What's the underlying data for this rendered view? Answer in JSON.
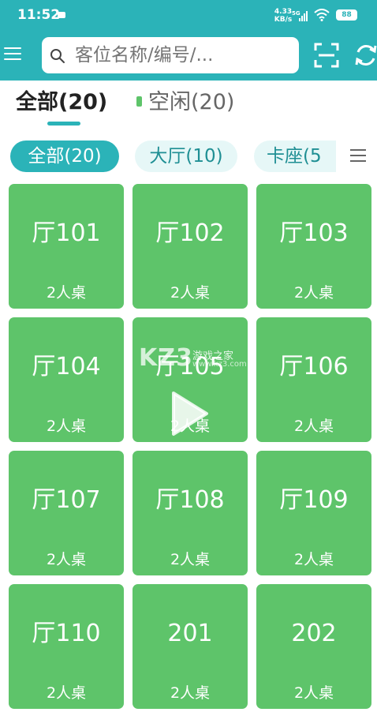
{
  "status_bar": {
    "time": "11:52",
    "net_speed_value": "4.33",
    "net_speed_unit": "KB/s",
    "network": "5G",
    "battery": "88"
  },
  "header": {
    "search_placeholder": "客位名称/编号/..."
  },
  "status_tabs": [
    {
      "label": "全部(20)",
      "active": true
    },
    {
      "label": "空闲(20)",
      "active": false
    }
  ],
  "area_chips": [
    {
      "label": "全部(20)",
      "active": true
    },
    {
      "label": "大厅(10)",
      "active": false
    },
    {
      "label": "卡座(5",
      "active": false
    }
  ],
  "tables": [
    {
      "name": "厅101",
      "seats": "2人桌"
    },
    {
      "name": "厅102",
      "seats": "2人桌"
    },
    {
      "name": "厅103",
      "seats": "2人桌"
    },
    {
      "name": "厅104",
      "seats": "2人桌"
    },
    {
      "name": "厅105",
      "seats": "2人桌"
    },
    {
      "name": "厅106",
      "seats": "2人桌"
    },
    {
      "name": "厅107",
      "seats": "2人桌"
    },
    {
      "name": "厅108",
      "seats": "2人桌"
    },
    {
      "name": "厅109",
      "seats": "2人桌"
    },
    {
      "name": "厅110",
      "seats": "2人桌"
    },
    {
      "name": "201",
      "seats": "2人桌"
    },
    {
      "name": "202",
      "seats": "2人桌"
    }
  ],
  "watermark": {
    "logo": "KZ3",
    "text": "游戏之家",
    "url": "www.kz3.com"
  },
  "colors": {
    "primary": "#2bb3b8",
    "table_idle": "#5ec46a",
    "chip_inactive_bg": "#e6f7f7"
  },
  "icons": [
    "menu-icon",
    "search-icon",
    "scan-icon",
    "refresh-icon",
    "list-icon",
    "play-icon"
  ]
}
